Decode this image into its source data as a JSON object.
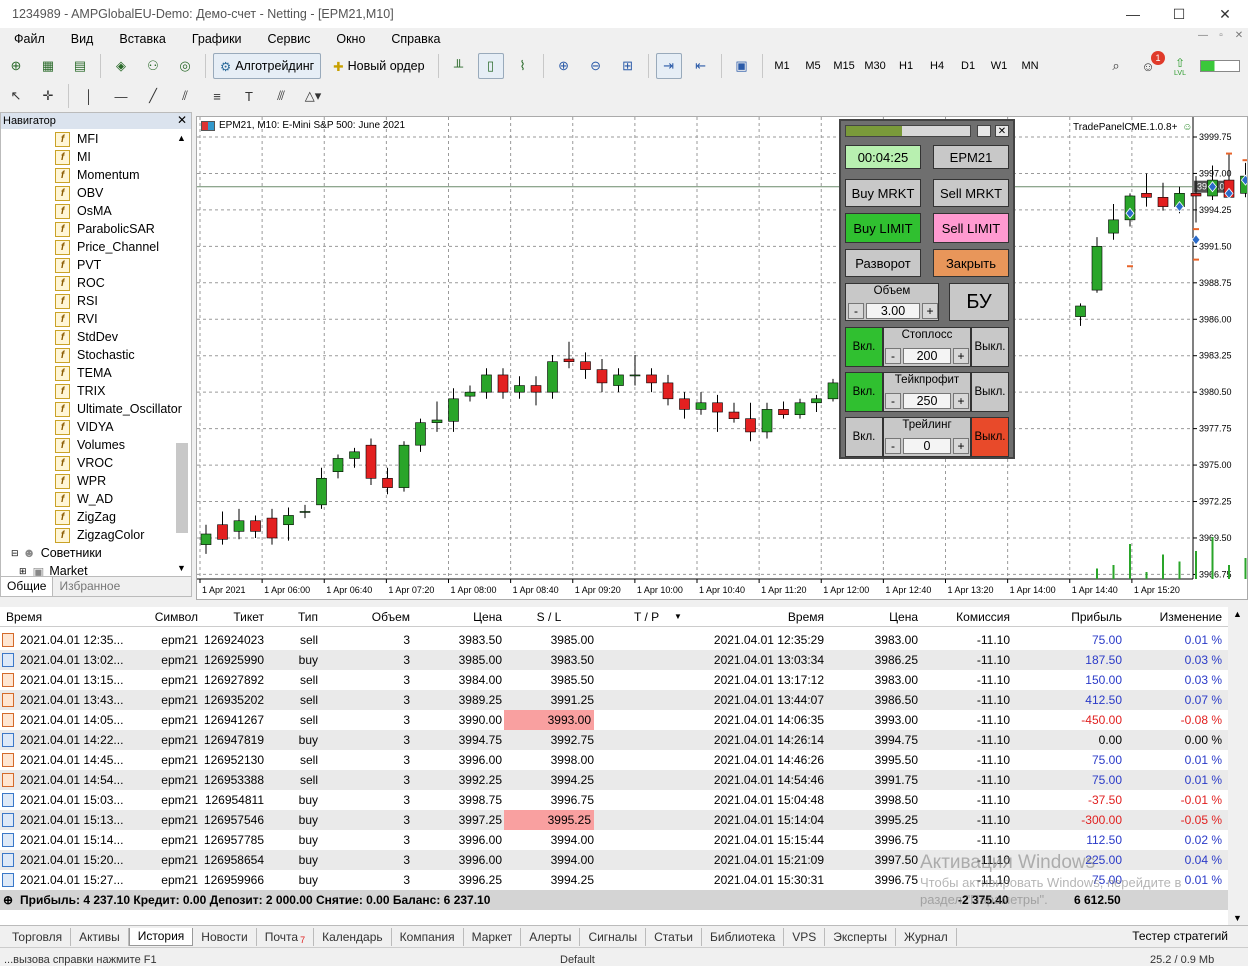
{
  "window": {
    "title": "1234989 - AMPGlobalEU-Demo: Демо-счет - Netting - [EPM21,M10]"
  },
  "menu": [
    "Файл",
    "Вид",
    "Вставка",
    "Графики",
    "Сервис",
    "Окно",
    "Справка"
  ],
  "toolbar": {
    "algo_label": "Алготрейдинг",
    "new_order_label": "Новый ордер",
    "timeframes": [
      "M1",
      "M5",
      "M15",
      "M30",
      "H1",
      "H4",
      "D1",
      "W1",
      "MN"
    ],
    "notif_count": "1",
    "lvl": "LVL"
  },
  "navigator": {
    "title": "Навигатор",
    "indicators": [
      "MFI",
      "MI",
      "Momentum",
      "OBV",
      "OsMA",
      "ParabolicSAR",
      "Price_Channel",
      "PVT",
      "ROC",
      "RSI",
      "RVI",
      "StdDev",
      "Stochastic",
      "TEMA",
      "TRIX",
      "Ultimate_Oscillator",
      "VIDYA",
      "Volumes",
      "VROC",
      "WPR",
      "W_AD",
      "ZigZag",
      "ZigzagColor"
    ],
    "advisors": "Советники",
    "market": "Market",
    "tabs": [
      "Общие",
      "Избранное"
    ]
  },
  "chart": {
    "header": "EPM21, M10:  E-Mini S&P 500: June 2021",
    "tradepanel_label": "TradePanelCME.1.0.8+",
    "price_label": "3996.00",
    "y_ticks": [
      "3999.75",
      "3997.00",
      "3994.25",
      "3991.50",
      "3988.75",
      "3986.00",
      "3983.25",
      "3980.50",
      "3977.75",
      "3975.00",
      "3972.25",
      "3969.50",
      "3966.75"
    ],
    "x_ticks": [
      "1 Apr 2021",
      "1 Apr 06:00",
      "1 Apr 06:40",
      "1 Apr 07:20",
      "1 Apr 08:00",
      "1 Apr 08:40",
      "1 Apr 09:20",
      "1 Apr 10:00",
      "1 Apr 10:40",
      "1 Apr 11:20",
      "1 Apr 12:00",
      "1 Apr 12:40",
      "1 Apr 13:20",
      "1 Apr 14:00",
      "1 Apr 14:40",
      "1 Apr 15:20"
    ],
    "candles": [
      [
        3969.0,
        3970.5,
        3968.3,
        3969.8
      ],
      [
        3970.5,
        3971.5,
        3969.0,
        3969.4
      ],
      [
        3970.0,
        3971.7,
        3969.4,
        3970.8
      ],
      [
        3970.8,
        3971.2,
        3969.5,
        3970.0
      ],
      [
        3971.0,
        3971.7,
        3969.0,
        3969.5
      ],
      [
        3970.5,
        3971.8,
        3969.3,
        3971.2
      ],
      [
        3971.5,
        3972.0,
        3971.0,
        3971.5
      ],
      [
        3972.0,
        3974.8,
        3971.7,
        3974.0
      ],
      [
        3974.5,
        3975.8,
        3974.0,
        3975.5
      ],
      [
        3975.5,
        3976.3,
        3974.8,
        3976.0
      ],
      [
        3976.5,
        3977.0,
        3973.5,
        3974.0
      ],
      [
        3974.0,
        3974.8,
        3972.8,
        3973.3
      ],
      [
        3973.3,
        3976.8,
        3973.0,
        3976.5
      ],
      [
        3976.5,
        3978.5,
        3976.0,
        3978.2
      ],
      [
        3978.2,
        3979.8,
        3977.5,
        3978.4
      ],
      [
        3978.3,
        3980.8,
        3977.5,
        3980.0
      ],
      [
        3980.2,
        3981.0,
        3979.8,
        3980.5
      ],
      [
        3980.5,
        3982.3,
        3980.0,
        3981.8
      ],
      [
        3981.8,
        3982.3,
        3980.0,
        3980.5
      ],
      [
        3980.5,
        3981.7,
        3980.0,
        3981.0
      ],
      [
        3981.0,
        3981.7,
        3979.5,
        3980.5
      ],
      [
        3980.5,
        3983.3,
        3980.0,
        3982.8
      ],
      [
        3983.0,
        3984.3,
        3982.3,
        3982.8
      ],
      [
        3982.8,
        3983.5,
        3981.5,
        3982.2
      ],
      [
        3982.2,
        3983.0,
        3980.5,
        3981.2
      ],
      [
        3981.0,
        3982.3,
        3980.5,
        3981.8
      ],
      [
        3981.8,
        3983.3,
        3981.0,
        3981.8
      ],
      [
        3981.8,
        3982.3,
        3980.5,
        3981.2
      ],
      [
        3981.2,
        3981.8,
        3979.5,
        3980.0
      ],
      [
        3980.0,
        3980.5,
        3978.5,
        3979.2
      ],
      [
        3979.2,
        3980.5,
        3978.8,
        3979.7
      ],
      [
        3979.7,
        3980.3,
        3977.5,
        3979.0
      ],
      [
        3979.0,
        3979.7,
        3978.2,
        3978.5
      ],
      [
        3978.5,
        3979.7,
        3976.8,
        3977.5
      ],
      [
        3977.5,
        3979.7,
        3977.0,
        3979.2
      ],
      [
        3979.2,
        3979.8,
        3978.5,
        3978.8
      ],
      [
        3978.8,
        3980.0,
        3978.5,
        3979.7
      ],
      [
        3979.7,
        3980.3,
        3979.0,
        3980.0
      ],
      [
        3980.0,
        3981.5,
        3979.8,
        3981.2
      ],
      [
        3981.2,
        3983.0,
        3980.5,
        3982.0
      ],
      [
        3982.0,
        3983.5,
        3980.5,
        3982.8
      ],
      [
        3986.2,
        3987.2,
        3985.5,
        3987.0
      ],
      [
        3988.2,
        3992.2,
        3988.0,
        3991.5
      ],
      [
        3992.5,
        3994.7,
        3992.0,
        3993.5
      ],
      [
        3993.5,
        3995.5,
        3993.0,
        3995.3
      ],
      [
        3995.5,
        3997.0,
        3994.5,
        3995.2
      ],
      [
        3995.2,
        3996.3,
        3994.2,
        3994.5
      ],
      [
        3994.5,
        3996.0,
        3994.0,
        3995.5
      ],
      [
        3995.5,
        3996.8,
        3993.3,
        3995.3
      ],
      [
        3995.3,
        3997.6,
        3995.0,
        3996.5
      ],
      [
        3996.5,
        3998.5,
        3995.2,
        3995.2
      ],
      [
        3995.5,
        3997.8,
        3995.2,
        3996.8
      ],
      [
        3996.0,
        3997.5,
        3995.0,
        3995.8
      ],
      [
        3995.8,
        3997.8,
        3995.2,
        3996.0
      ]
    ],
    "volumes": [
      0,
      0,
      0,
      0,
      0,
      0,
      0,
      0,
      0,
      0,
      0,
      0,
      0,
      0,
      0,
      0,
      0,
      0,
      0,
      0,
      0,
      0,
      0,
      0,
      0,
      0,
      0,
      0,
      0,
      0,
      0,
      0,
      0,
      0,
      0,
      0,
      0,
      0,
      0,
      0,
      0,
      0,
      3,
      4,
      10,
      2,
      7,
      5,
      8,
      12,
      4,
      6,
      3,
      4
    ]
  },
  "panel": {
    "time": "00:04:25",
    "symbol": "EPM21",
    "buy_market": "Buy MRKT",
    "sell_market": "Sell MRKT",
    "buy_limit": "Buy LIMIT",
    "sell_limit": "Sell LIMIT",
    "reverse": "Разворот",
    "close": "Закрыть",
    "volume_label": "Объем",
    "volume": "3.00",
    "breakeven": "БУ",
    "stoploss_label": "Стоплосс",
    "stoploss": "200",
    "takeprofit_label": "Тейкпрофит",
    "takeprofit": "250",
    "trailing_label": "Трейлинг",
    "trailing": "0",
    "on": "Вкл.",
    "off": "Выкл.",
    "minus": "-",
    "plus": "+"
  },
  "history": {
    "headers": [
      "Время",
      "Символ",
      "Тикет",
      "Тип",
      "Объем",
      "Цена",
      "S / L",
      "T / P",
      "Время",
      "Цена",
      "Комиссия",
      "Прибыль",
      "Изменение"
    ],
    "rows": [
      [
        "2021.04.01 12:35...",
        "epm21",
        "126924023",
        "sell",
        "3",
        "3983.50",
        "3985.00",
        "",
        "2021.04.01 12:35:29",
        "3983.00",
        "-11.10",
        "75.00",
        "0.01 %"
      ],
      [
        "2021.04.01 13:02...",
        "epm21",
        "126925990",
        "buy",
        "3",
        "3985.00",
        "3983.50",
        "",
        "2021.04.01 13:03:34",
        "3986.25",
        "-11.10",
        "187.50",
        "0.03 %"
      ],
      [
        "2021.04.01 13:15...",
        "epm21",
        "126927892",
        "sell",
        "3",
        "3984.00",
        "3985.50",
        "",
        "2021.04.01 13:17:12",
        "3983.00",
        "-11.10",
        "150.00",
        "0.03 %"
      ],
      [
        "2021.04.01 13:43...",
        "epm21",
        "126935202",
        "sell",
        "3",
        "3989.25",
        "3991.25",
        "",
        "2021.04.01 13:44:07",
        "3986.50",
        "-11.10",
        "412.50",
        "0.07 %"
      ],
      [
        "2021.04.01 14:05...",
        "epm21",
        "126941267",
        "sell",
        "3",
        "3990.00",
        "3993.00",
        "",
        "2021.04.01 14:06:35",
        "3993.00",
        "-11.10",
        "-450.00",
        "-0.08 %"
      ],
      [
        "2021.04.01 14:22...",
        "epm21",
        "126947819",
        "buy",
        "3",
        "3994.75",
        "3992.75",
        "",
        "2021.04.01 14:26:14",
        "3994.75",
        "-11.10",
        "0.00",
        "0.00 %"
      ],
      [
        "2021.04.01 14:45...",
        "epm21",
        "126952130",
        "sell",
        "3",
        "3996.00",
        "3998.00",
        "",
        "2021.04.01 14:46:26",
        "3995.50",
        "-11.10",
        "75.00",
        "0.01 %"
      ],
      [
        "2021.04.01 14:54...",
        "epm21",
        "126953388",
        "sell",
        "3",
        "3992.25",
        "3994.25",
        "",
        "2021.04.01 14:54:46",
        "3991.75",
        "-11.10",
        "75.00",
        "0.01 %"
      ],
      [
        "2021.04.01 15:03...",
        "epm21",
        "126954811",
        "buy",
        "3",
        "3998.75",
        "3996.75",
        "",
        "2021.04.01 15:04:48",
        "3998.50",
        "-11.10",
        "-37.50",
        "-0.01 %"
      ],
      [
        "2021.04.01 15:13...",
        "epm21",
        "126957546",
        "buy",
        "3",
        "3997.25",
        "3995.25",
        "",
        "2021.04.01 15:14:04",
        "3995.25",
        "-11.10",
        "-300.00",
        "-0.05 %"
      ],
      [
        "2021.04.01 15:14...",
        "epm21",
        "126957785",
        "buy",
        "3",
        "3996.00",
        "3994.00",
        "",
        "2021.04.01 15:15:44",
        "3996.75",
        "-11.10",
        "112.50",
        "0.02 %"
      ],
      [
        "2021.04.01 15:20...",
        "epm21",
        "126958654",
        "buy",
        "3",
        "3996.00",
        "3994.00",
        "",
        "2021.04.01 15:21:09",
        "3997.50",
        "-11.10",
        "225.00",
        "0.04 %"
      ],
      [
        "2021.04.01 15:27...",
        "epm21",
        "126959966",
        "buy",
        "3",
        "3996.25",
        "3994.25",
        "",
        "2021.04.01 15:30:31",
        "3996.75",
        "-11.10",
        "75.00",
        "0.01 %"
      ]
    ],
    "highlight_sl_rows": [
      4,
      9
    ],
    "summary": {
      "text": "Прибыль: 4 237.10  Кредит: 0.00  Депозит: 2 000.00  Снятие: 0.00  Баланс: 6 237.10",
      "commission": "-2 375.40",
      "profit": "6 612.50"
    }
  },
  "bottom_tabs": [
    "Торговля",
    "Активы",
    "История",
    "Новости",
    "Почта",
    "Календарь",
    "Компания",
    "Маркет",
    "Алерты",
    "Сигналы",
    "Статьи",
    "Библиотека",
    "VPS",
    "Эксперты",
    "Журнал"
  ],
  "mail_count": "7",
  "tester": "Тестер стратегий",
  "status": {
    "left": "...вызова справки нажмите F1",
    "profile": "Default",
    "traffic": "25.2 / 0.9 Mb"
  },
  "watermark": {
    "line1": "Активация Windows",
    "line2": "Чтобы активировать Windows, перейдите в",
    "line3": "раздел \"Параметры\"."
  },
  "colors": {
    "bull": "#2aa52a",
    "bear": "#e32020",
    "profit_pos": "#2a3ac8",
    "profit_neg": "#e02020"
  }
}
